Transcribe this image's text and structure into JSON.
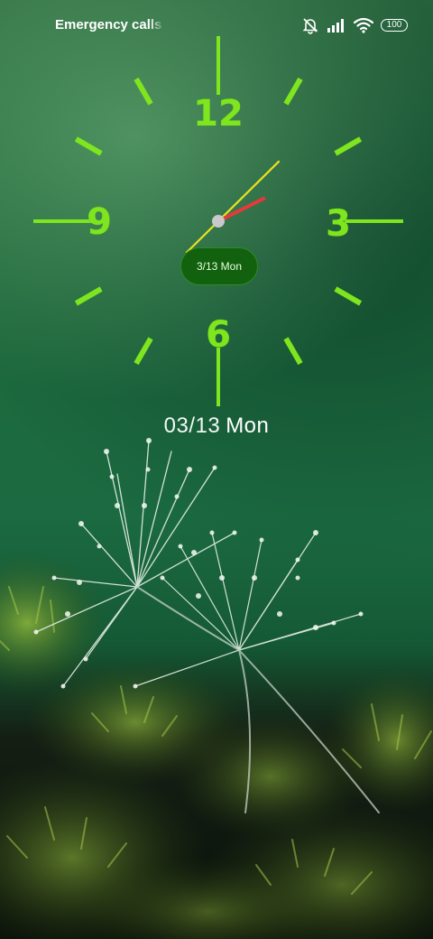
{
  "status_bar": {
    "carrier_text": "Emergency calls only",
    "icons": [
      "notifications-muted-icon",
      "signal-icon",
      "wifi-icon",
      "battery-icon"
    ],
    "battery_level": "100"
  },
  "clock": {
    "numerals": {
      "twelve": "12",
      "three": "3",
      "six": "6",
      "nine": "9"
    },
    "time": {
      "hour": 2,
      "minute": 7,
      "second": 34
    },
    "date_pill": "3/13 Mon",
    "colors": {
      "marks": "#7ee51e",
      "hour_hand": "#e53a3a",
      "minute_hand": "#e8e31e",
      "pill": "#12610f"
    }
  },
  "date": {
    "numeric": "03/13",
    "weekday": "Mon"
  },
  "wallpaper": {
    "subject": "dandelion seeds with dew drops on moss",
    "accent": "#1b6a41"
  }
}
